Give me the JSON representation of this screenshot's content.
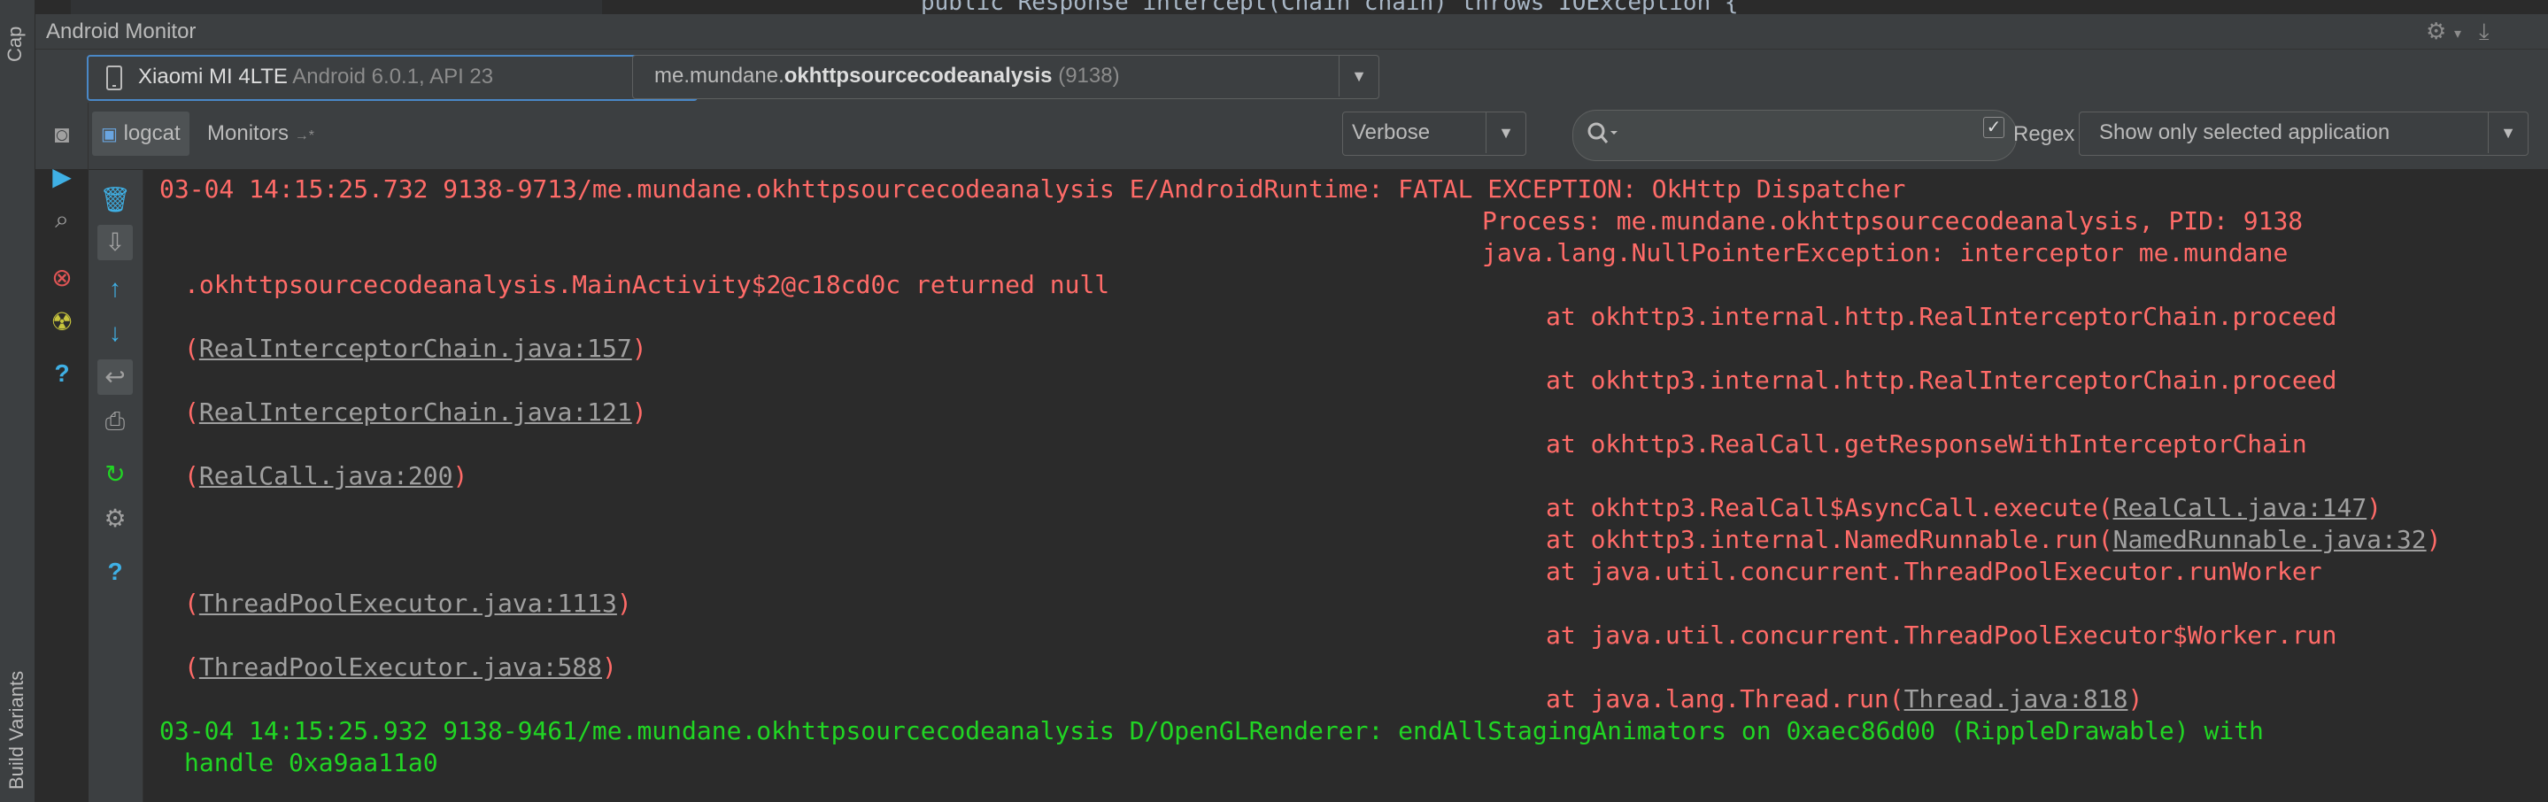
{
  "left_strip": {
    "top_label": "Cap",
    "bottom_label": "Build Variants"
  },
  "editor_peek": {
    "code": "public Response intercept(Chain chain) throws IOException {"
  },
  "window": {
    "title": "Android Monitor"
  },
  "device": {
    "name": "Xiaomi MI 4LTE",
    "detail": "Android 6.0.1, API 23"
  },
  "process": {
    "prefix": "me.mundane.",
    "bold": "okhttpsourcecodeanalysis",
    "pid": "(9138)"
  },
  "tabs": {
    "logcat": "logcat",
    "monitors": "Monitors"
  },
  "level": {
    "selected": "Verbose"
  },
  "search": {
    "placeholder": ""
  },
  "regex": {
    "label": "Regex",
    "checked": true
  },
  "filter": {
    "selected": "Show only selected application"
  },
  "icons": {
    "left": [
      "camera-icon",
      "run-icon",
      "search-device-icon",
      "stop-icon",
      "debug-icon",
      "help-icon"
    ],
    "tools": [
      "trash-icon",
      "scroll-to-end-icon",
      "up-arrow-icon",
      "down-arrow-icon",
      "soft-wrap-icon",
      "print-icon",
      "restart-icon",
      "settings-icon",
      "help-icon"
    ]
  },
  "log": {
    "lines": [
      {
        "text": "03-04 14:15:25.732 9138-9713/me.mundane.okhttpsourcecodeanalysis E/AndroidRuntime: FATAL EXCEPTION: OkHttp Dispatcher"
      },
      {
        "text": "Process: me.mundane.okhttpsourcecodeanalysis, PID: 9138"
      },
      {
        "text": "java.lang.NullPointerException: interceptor me.mundane"
      },
      {
        "text": ".okhttpsourcecodeanalysis.MainActivity$2@c18cd0c returned null"
      },
      {
        "text": "at okhttp3.internal.http.RealInterceptorChain.proceed"
      },
      {
        "link": "RealInterceptorChain.java:157"
      },
      {
        "text": "at okhttp3.internal.http.RealInterceptorChain.proceed"
      },
      {
        "link": "RealInterceptorChain.java:121"
      },
      {
        "text": "at okhttp3.RealCall.getResponseWithInterceptorChain"
      },
      {
        "link": "RealCall.java:200"
      },
      {
        "text": "at okhttp3.RealCall$AsyncCall.execute(",
        "link": "RealCall.java:147"
      },
      {
        "text": "at okhttp3.internal.NamedRunnable.run(",
        "link": "NamedRunnable.java:32"
      },
      {
        "text": "at java.util.concurrent.ThreadPoolExecutor.runWorker"
      },
      {
        "link": "ThreadPoolExecutor.java:1113"
      },
      {
        "text": "at java.util.concurrent.ThreadPoolExecutor$Worker.run"
      },
      {
        "link": "ThreadPoolExecutor.java:588"
      },
      {
        "text": "at java.lang.Thread.run(",
        "link": "Thread.java:818"
      },
      {
        "text": "03-04 14:15:25.932 9138-9461/me.mundane.okhttpsourcecodeanalysis D/OpenGLRenderer: endAllStagingAnimators on 0xaec86d00 (RippleDrawable) with"
      },
      {
        "text": "handle 0xa9aa11a0"
      }
    ]
  },
  "colors": {
    "error": "#ff6b68",
    "debug": "#21d524",
    "background": "#2b2b2b",
    "panel": "#3c3f41"
  }
}
